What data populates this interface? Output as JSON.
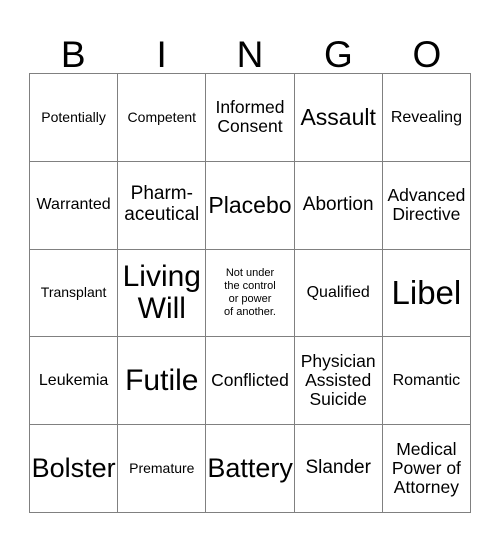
{
  "header": {
    "letters": [
      "B",
      "I",
      "N",
      "G",
      "O"
    ]
  },
  "grid": {
    "rows": 5,
    "columns": 5,
    "border_color": "#808080",
    "cell_background": "#ffffff",
    "text_color": "#000000",
    "cells": [
      {
        "text": "Potentially",
        "size": "s"
      },
      {
        "text": "Competent",
        "size": "s"
      },
      {
        "text": "Informed\nConsent",
        "size": "ml"
      },
      {
        "text": "Assault",
        "size": "xl"
      },
      {
        "text": "Revealing",
        "size": "m"
      },
      {
        "text": "Warranted",
        "size": "m"
      },
      {
        "text": "Pharm-\naceutical",
        "size": "l"
      },
      {
        "text": "Placebo",
        "size": "xl"
      },
      {
        "text": "Abortion",
        "size": "l"
      },
      {
        "text": "Advanced\nDirective",
        "size": "ml"
      },
      {
        "text": "Transplant",
        "size": "s"
      },
      {
        "text": "Living\nWill",
        "size": "3xl"
      },
      {
        "text": "Not under\nthe control\nor power\nof another.",
        "size": "xs"
      },
      {
        "text": "Qualified",
        "size": "m"
      },
      {
        "text": "Libel",
        "size": "4xl"
      },
      {
        "text": "Leukemia",
        "size": "m"
      },
      {
        "text": "Futile",
        "size": "3xl"
      },
      {
        "text": "Conflicted",
        "size": "ml"
      },
      {
        "text": "Physician\nAssisted\nSuicide",
        "size": "ml"
      },
      {
        "text": "Romantic",
        "size": "m"
      },
      {
        "text": "Bolster",
        "size": "2xl"
      },
      {
        "text": "Premature",
        "size": "s"
      },
      {
        "text": "Battery",
        "size": "2xl"
      },
      {
        "text": "Slander",
        "size": "l"
      },
      {
        "text": "Medical\nPower of\nAttorney",
        "size": "ml"
      }
    ]
  }
}
